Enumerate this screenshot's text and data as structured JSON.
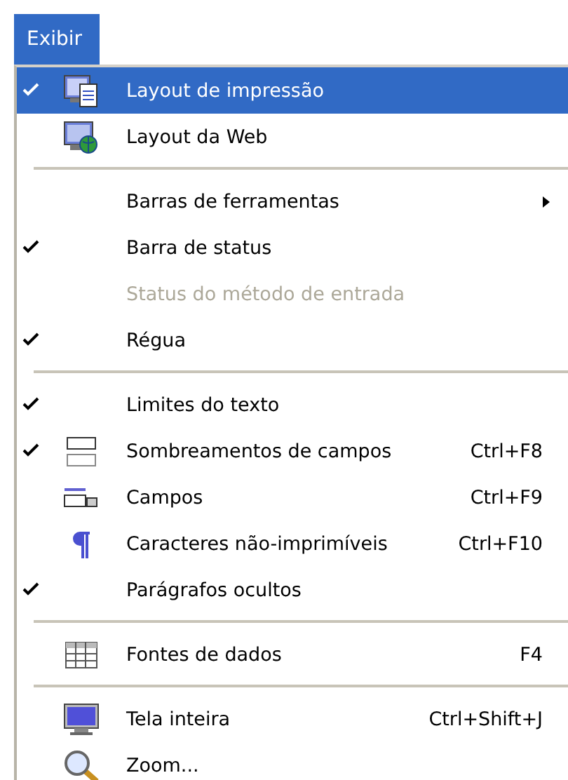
{
  "menu_title": "Exibir",
  "items": [
    {
      "kind": "item",
      "label": "Layout de impressão",
      "checked": true,
      "selected": true
    },
    {
      "kind": "item",
      "label": "Layout da Web",
      "checked": false,
      "selected": false
    },
    {
      "kind": "separator"
    },
    {
      "kind": "item",
      "label": "Barras de ferramentas",
      "checked": false,
      "selected": false,
      "submenu": true
    },
    {
      "kind": "item",
      "label": "Barra de status",
      "checked": true,
      "selected": false
    },
    {
      "kind": "item",
      "label": "Status do método de entrada",
      "checked": false,
      "selected": false,
      "disabled": true
    },
    {
      "kind": "item",
      "label": "Régua",
      "checked": true,
      "selected": false
    },
    {
      "kind": "separator"
    },
    {
      "kind": "item",
      "label": "Limites do texto",
      "checked": true,
      "selected": false
    },
    {
      "kind": "item",
      "label": "Sombreamentos de campos",
      "checked": true,
      "selected": false,
      "shortcut": "Ctrl+F8"
    },
    {
      "kind": "item",
      "label": "Campos",
      "checked": false,
      "selected": false,
      "shortcut": "Ctrl+F9"
    },
    {
      "kind": "item",
      "label": "Caracteres não-imprimíveis",
      "checked": false,
      "selected": false,
      "shortcut": "Ctrl+F10"
    },
    {
      "kind": "item",
      "label": "Parágrafos ocultos",
      "checked": true,
      "selected": false
    },
    {
      "kind": "separator"
    },
    {
      "kind": "item",
      "label": "Fontes de dados",
      "checked": false,
      "selected": false,
      "shortcut": "F4"
    },
    {
      "kind": "separator"
    },
    {
      "kind": "item",
      "label": "Tela inteira",
      "checked": false,
      "selected": false,
      "shortcut": "Ctrl+Shift+J"
    },
    {
      "kind": "item",
      "label": "Zoom...",
      "checked": false,
      "selected": false
    }
  ]
}
